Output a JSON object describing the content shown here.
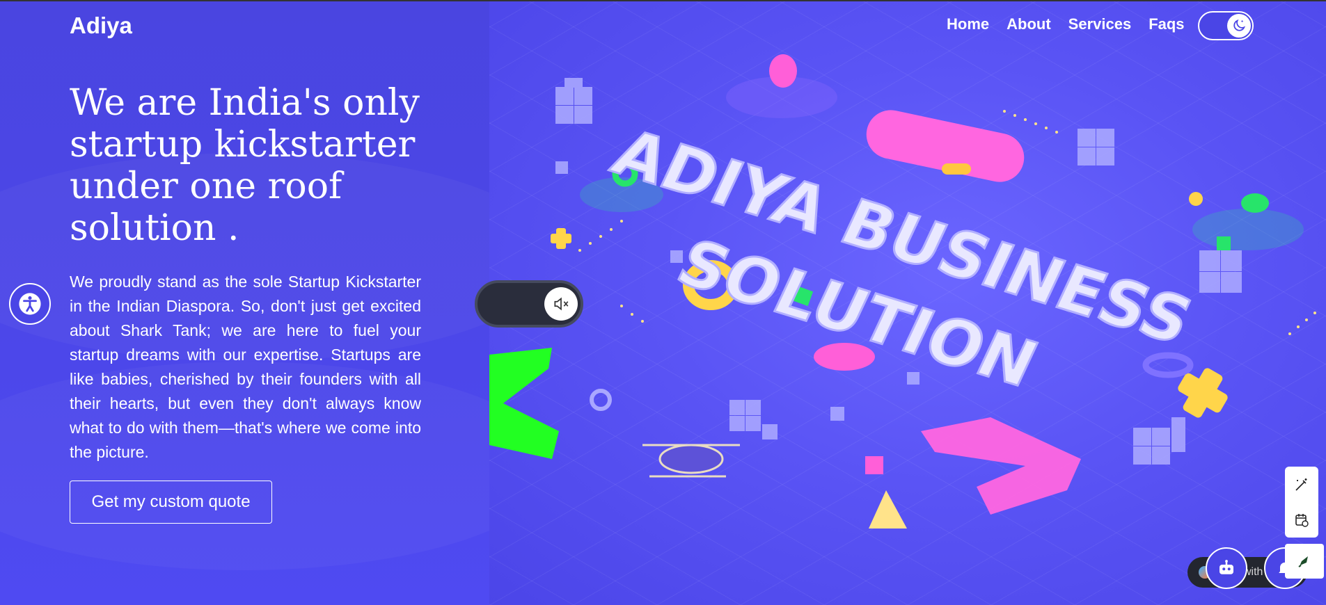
{
  "brand": {
    "logo": "Adiya"
  },
  "nav": {
    "items": [
      {
        "label": "Home"
      },
      {
        "label": "About"
      },
      {
        "label": "Services"
      },
      {
        "label": "Faqs"
      }
    ],
    "theme_toggle_icon": "moon-icon"
  },
  "hero": {
    "headline": "We are India's only startup kickstarter under one roof solution .",
    "description": "We proudly stand as the sole Startup Kickstarter in the Indian Diaspora. So, don't just get excited about Shark Tank; we are here to fuel your startup dreams with our expertise. Startups are like babies, cherished by their founders with all their hearts, but even they don't always know what to do with them—that's where we come into the picture.",
    "cta_label": "Get my custom quote",
    "banner_text_line1": "ADIYA BUSINESS",
    "banner_text_line2": "SOLUTION"
  },
  "widgets": {
    "accessibility_icon": "accessibility-icon",
    "mute_icon": "speaker-muted-icon",
    "chat_label": "with",
    "bot_icon": "robot-icon",
    "bell_icon": "bell-icon",
    "tool_icons": [
      "magic-edit-icon",
      "schedule-icon"
    ],
    "rocket_icon": "rocket-icon"
  },
  "colors": {
    "primary": "#4a45e6",
    "banner_bg": "#5a54f5",
    "neon_green": "#22ff22",
    "pink": "#ff66e0",
    "yellow": "#ffd54a"
  }
}
